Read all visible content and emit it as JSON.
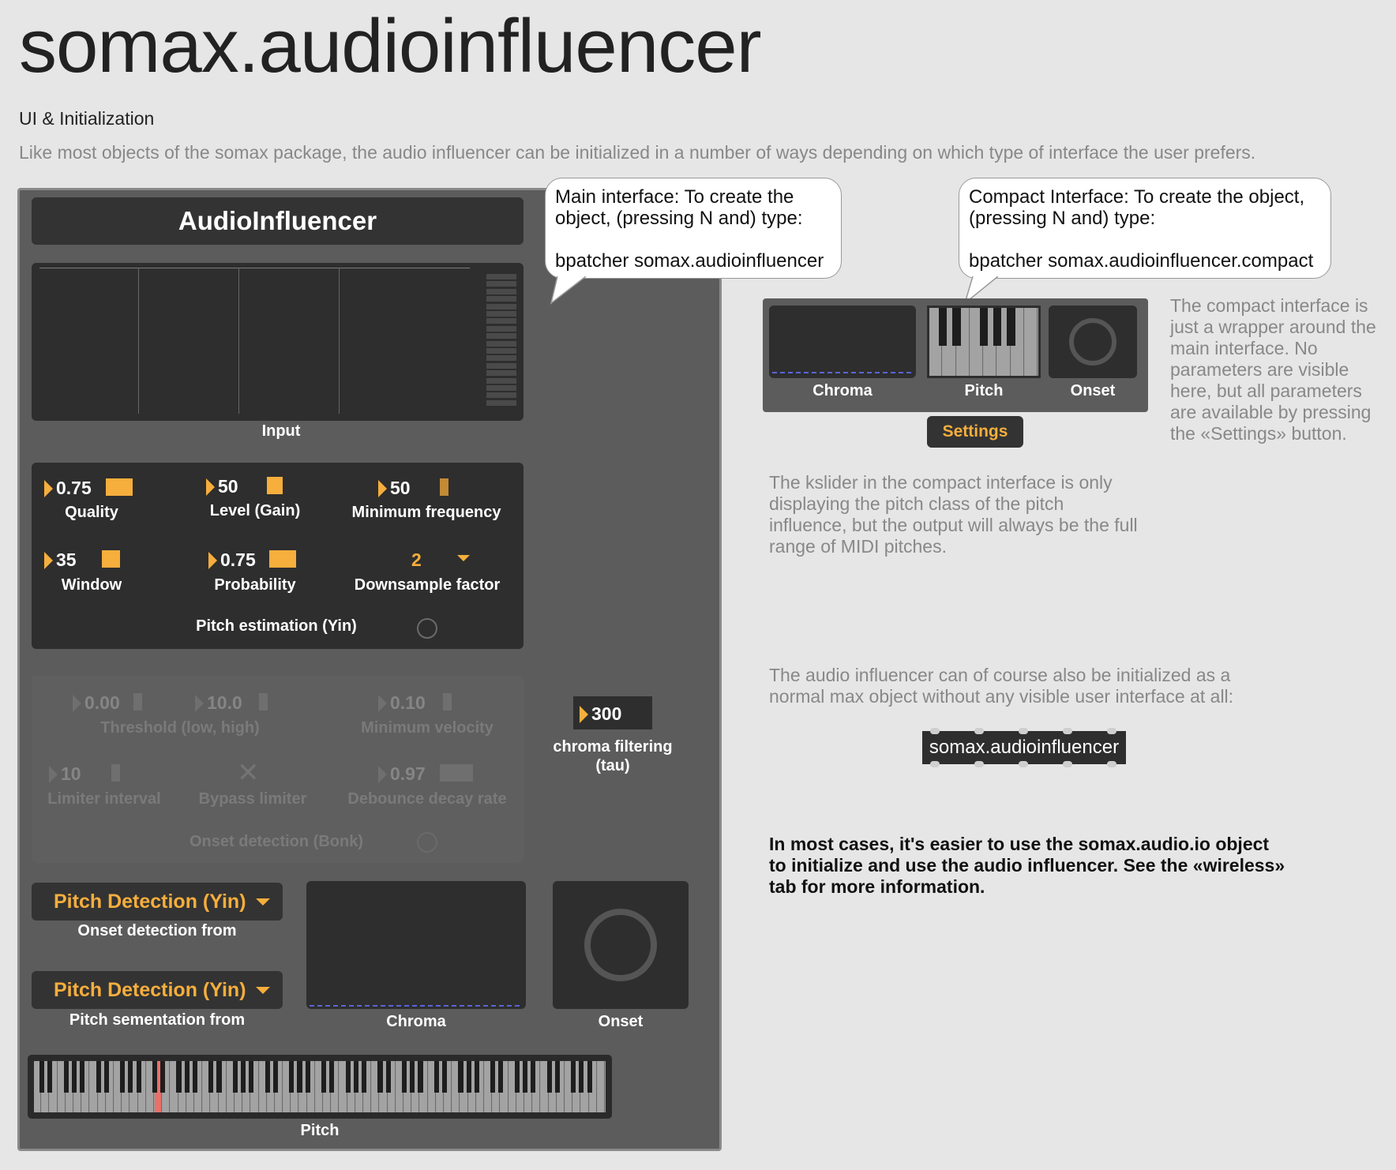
{
  "page": {
    "title": "somax.audioinfluencer",
    "subtitle": "UI & Initialization",
    "intro": "Like most objects of the somax package, the audio influencer can be initialized in a number of ways depending on which type of  interface the user prefers."
  },
  "main_ui": {
    "header": "AudioInfluencer",
    "input_label": "Input",
    "params": {
      "quality": {
        "value": "0.75",
        "label": "Quality"
      },
      "level": {
        "value": "50",
        "label": "Level (Gain)"
      },
      "min_freq": {
        "value": "50",
        "label": "Minimum frequency"
      },
      "window": {
        "value": "35",
        "label": "Window"
      },
      "probability": {
        "value": "0.75",
        "label": "Probability"
      },
      "downsample": {
        "value": "2",
        "label": "Downsample factor"
      },
      "pitch_estimation": "Pitch estimation (Yin)"
    },
    "onset_params": {
      "threshold_low": "0.00",
      "threshold_high": "10.0",
      "threshold_label": "Threshold (low, high)",
      "min_velocity": {
        "value": "0.10",
        "label": "Minimum velocity"
      },
      "limiter_interval": {
        "value": "10",
        "label": "Limiter interval"
      },
      "bypass_limiter": "Bypass limiter",
      "debounce": {
        "value": "0.97",
        "label": "Debounce decay rate"
      },
      "onset_detection": "Onset detection (Bonk)"
    },
    "chroma_filter": {
      "value": "300",
      "label": "chroma filtering\n(tau)"
    },
    "onset_from": {
      "selected": "Pitch Detection (Yin)",
      "label": "Onset detection from"
    },
    "pitch_seg_from": {
      "selected": "Pitch Detection (Yin)",
      "label": "Pitch sementation from"
    },
    "chroma_label": "Chroma",
    "onset_label": "Onset",
    "pitch_label": "Pitch"
  },
  "bubbles": {
    "main": {
      "line1": "Main interface: To create the",
      "line2": "object, (pressing N and) type:",
      "code": "bpatcher somax.audioinfluencer"
    },
    "compact": {
      "line1": "Compact Interface: To create the object,",
      "line2": "(pressing N and) type:",
      "code": "bpatcher somax.audioinfluencer.compact"
    }
  },
  "compact_ui": {
    "chroma": "Chroma",
    "pitch": "Pitch",
    "onset": "Onset",
    "settings_button": "Settings"
  },
  "notes": {
    "compact_wrapper": "The compact interface is just a wrapper around the main interface. No parameters are visible here, but all parameters are available by pressing the «Settings» button.",
    "kslider": "The kslider in the compact interface is only displaying the pitch class of the pitch influence, but the output will always be the full range of MIDI pitches.",
    "normal_object": "The audio influencer can of course also be initialized as a normal max object without any visible user interface at all:",
    "object_box": "somax.audioinfluencer",
    "wireless": "In most cases, it's easier to use the somax.audio.io object to initialize and use the audio influencer. See the «wireless» tab for more information."
  },
  "colors": {
    "accent": "#f6ae3c",
    "panel": "#5c5c5c",
    "dark": "#2e2e2e",
    "pitch_highlight": "#e8706a"
  }
}
